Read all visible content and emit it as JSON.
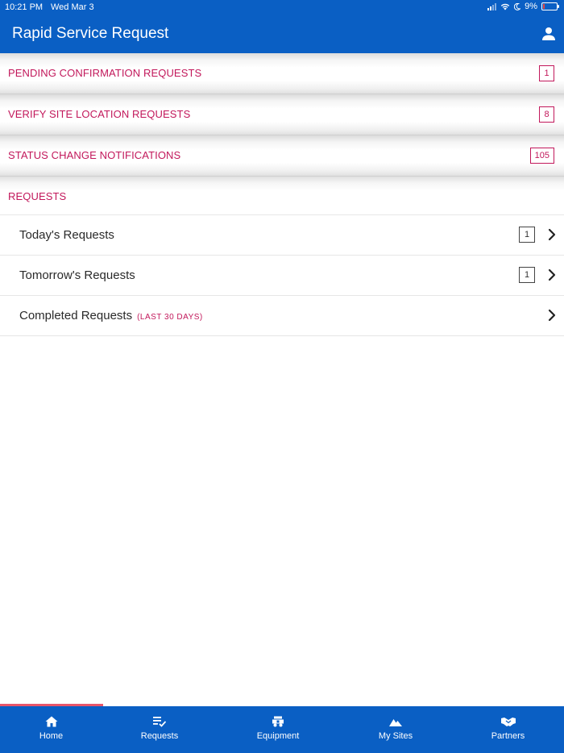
{
  "status_bar": {
    "time": "10:21 PM",
    "date": "Wed Mar 3",
    "battery": "9%"
  },
  "header": {
    "title": "Rapid Service Request",
    "user_icon": "user-icon"
  },
  "sections": [
    {
      "label": "PENDING CONFIRMATION REQUESTS",
      "count": "1"
    },
    {
      "label": "VERIFY SITE LOCATION REQUESTS",
      "count": "8"
    },
    {
      "label": "STATUS CHANGE NOTIFICATIONS",
      "count": "105"
    }
  ],
  "requests": {
    "header": "REQUESTS",
    "items": [
      {
        "label": "Today's Requests",
        "count": "1"
      },
      {
        "label": "Tomorrow's Requests",
        "count": "1"
      },
      {
        "label": "Completed Requests",
        "sublabel": "(LAST 30 DAYS)"
      }
    ]
  },
  "bottom_nav": {
    "active_index": 0,
    "tabs": [
      {
        "label": "Home",
        "icon": "home-icon"
      },
      {
        "label": "Requests",
        "icon": "requests-icon"
      },
      {
        "label": "Equipment",
        "icon": "equipment-icon"
      },
      {
        "label": "My Sites",
        "icon": "mountain-icon"
      },
      {
        "label": "Partners",
        "icon": "handshake-icon"
      }
    ]
  },
  "colors": {
    "brand_blue": "#0a5fc4",
    "accent_pink": "#c2185b",
    "active_tab_indicator": "#e8556a"
  }
}
